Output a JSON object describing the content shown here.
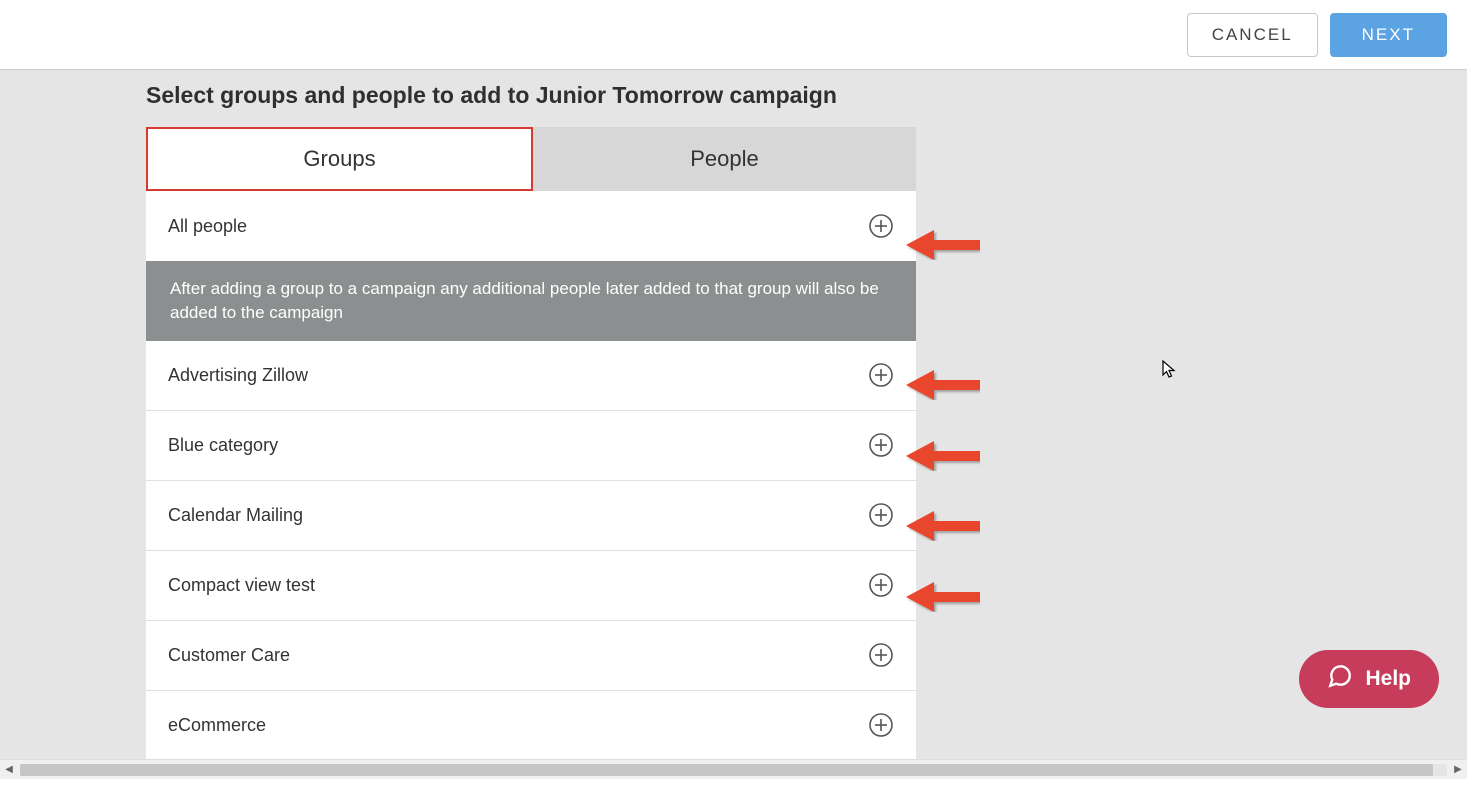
{
  "header": {
    "cancel": "CANCEL",
    "next": "NEXT"
  },
  "title": "Select groups and people to add to Junior Tomorrow campaign",
  "tabs": {
    "groups": "Groups",
    "people": "People"
  },
  "info": "After adding a group to a campaign any additional people later added to that group will also be added to the campaign",
  "groups": [
    "All people",
    "Advertising Zillow",
    "Blue category",
    "Calendar Mailing",
    "Compact view test",
    "Customer Care",
    "eCommerce"
  ],
  "help": "Help",
  "colors": {
    "primary_blue": "#4a9ae0",
    "red_highlight": "#d73a2e",
    "arrow_red": "#e8472f",
    "help_pink": "#c63c5a",
    "banner_gray": "#8b8f8f"
  }
}
